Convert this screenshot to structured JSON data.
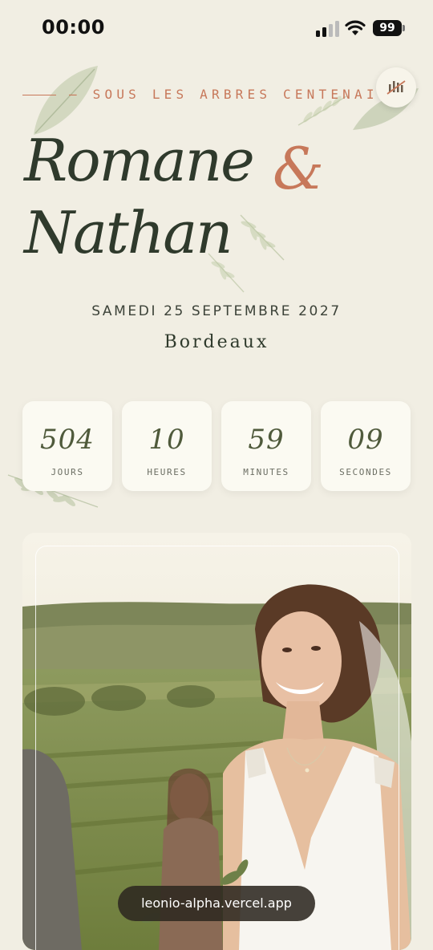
{
  "status_bar": {
    "time": "00:00",
    "battery": "99"
  },
  "hero": {
    "subtitle": "— SOUS LES ARBRES CENTENAIRES",
    "name_1": "Romane",
    "ampersand": "&",
    "name_2": "Nathan",
    "date": "SAMEDI 25 SEPTEMBRE 2027",
    "city": "Bordeaux"
  },
  "countdown": [
    {
      "value": "504",
      "label": "JOURS"
    },
    {
      "value": "10",
      "label": "HEURES"
    },
    {
      "value": "59",
      "label": "MINUTES"
    },
    {
      "value": "09",
      "label": "SECONDES"
    }
  ],
  "photo": {
    "description_icon": "bride-photo"
  },
  "browser": {
    "url": "leonio-alpha.vercel.app"
  },
  "colors": {
    "background": "#f1eee3",
    "accent": "#c7785a",
    "text": "#2f3a2c",
    "card": "#fbfaf2"
  }
}
